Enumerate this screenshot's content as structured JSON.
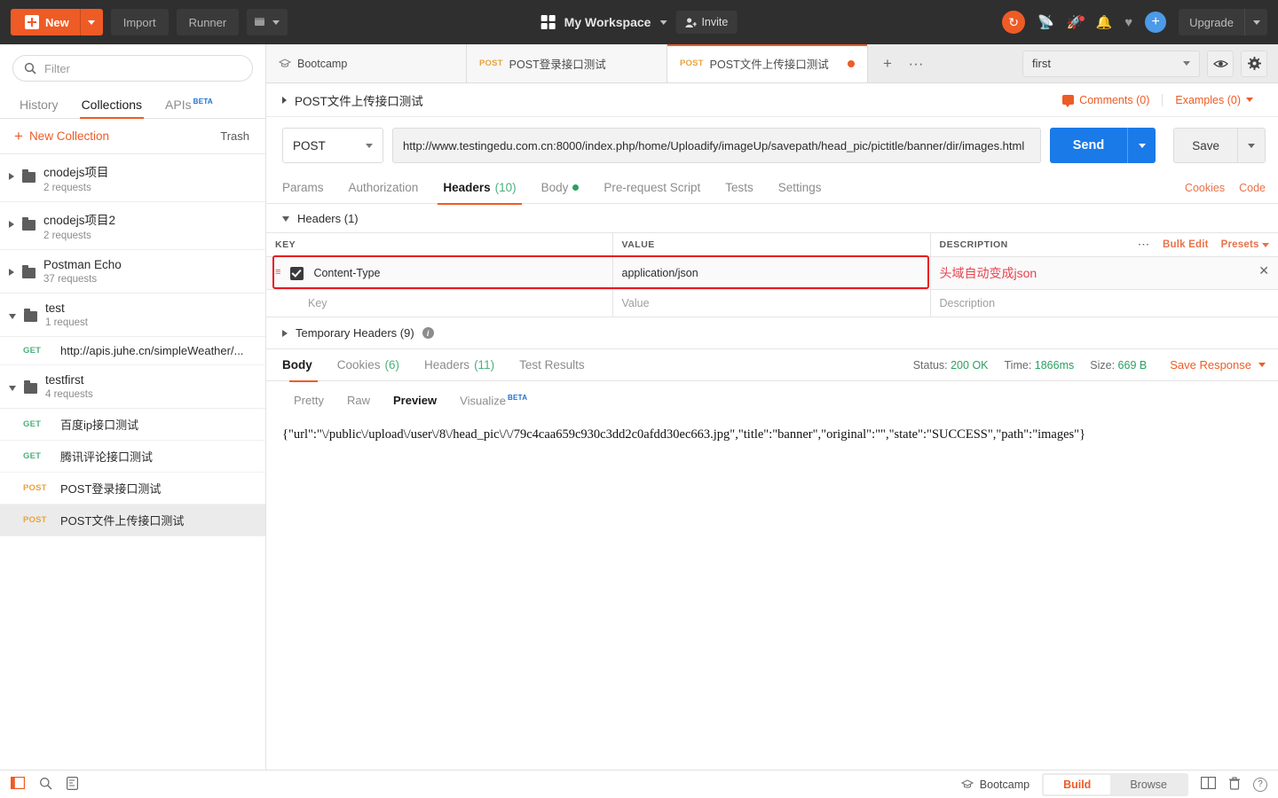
{
  "topbar": {
    "new_label": "New",
    "import_label": "Import",
    "runner_label": "Runner",
    "workspace_name": "My Workspace",
    "invite_label": "Invite",
    "upgrade_label": "Upgrade",
    "icons": [
      "sync-icon",
      "satellite-icon",
      "rocket-icon",
      "bell-icon",
      "heart-icon",
      "plus-circle-icon"
    ],
    "accent_color": "#ef5b25"
  },
  "sidebar": {
    "filter_placeholder": "Filter",
    "tabs": [
      {
        "label": "History",
        "active": false
      },
      {
        "label": "Collections",
        "active": true
      },
      {
        "label": "APIs",
        "active": false,
        "badge": "BETA"
      }
    ],
    "new_collection_label": "New Collection",
    "trash_label": "Trash",
    "collections": [
      {
        "name": "cnodejs项目",
        "count": "2 requests",
        "open": false,
        "requests": []
      },
      {
        "name": "cnodejs项目2",
        "count": "2 requests",
        "open": false,
        "requests": []
      },
      {
        "name": "Postman Echo",
        "count": "37 requests",
        "open": false,
        "requests": []
      },
      {
        "name": "test",
        "count": "1 request",
        "open": true,
        "requests": [
          {
            "method": "GET",
            "name": "http://apis.juhe.cn/simpleWeather/...",
            "selected": false
          }
        ]
      },
      {
        "name": "testfirst",
        "count": "4 requests",
        "open": true,
        "requests": [
          {
            "method": "GET",
            "name": "百度ip接口测试",
            "selected": false
          },
          {
            "method": "GET",
            "name": "腾讯评论接口测试",
            "selected": false
          },
          {
            "method": "POST",
            "name": "POST登录接口测试",
            "selected": false
          },
          {
            "method": "POST",
            "name": "POST文件上传接口测试",
            "selected": true
          }
        ]
      }
    ]
  },
  "tabstrip": {
    "tabs": [
      {
        "method": "",
        "title": "Bootcamp",
        "active": false,
        "unsaved": false,
        "icon": "bootcamp-icon"
      },
      {
        "method": "POST",
        "title": "POST登录接口测试",
        "active": false,
        "unsaved": false
      },
      {
        "method": "POST",
        "title": "POST文件上传接口测试",
        "active": true,
        "unsaved": true
      }
    ],
    "add_label": "+",
    "more_label": "···",
    "environment": "first"
  },
  "request": {
    "title": "POST文件上传接口测试",
    "comments_label": "Comments (0)",
    "examples_label": "Examples (0)",
    "method": "POST",
    "url": "http://www.testingedu.com.cn:8000/index.php/home/Uploadify/imageUp/savepath/head_pic/pictitle/banner/dir/images.html",
    "send_label": "Send",
    "save_label": "Save",
    "tabs": [
      {
        "label": "Params",
        "active": false
      },
      {
        "label": "Authorization",
        "active": false
      },
      {
        "label": "Headers",
        "count": "(10)",
        "active": true
      },
      {
        "label": "Body",
        "active": false,
        "dot": true
      },
      {
        "label": "Pre-request Script",
        "active": false
      },
      {
        "label": "Tests",
        "active": false
      },
      {
        "label": "Settings",
        "active": false
      }
    ],
    "cookies_link": "Cookies",
    "code_link": "Code"
  },
  "headers": {
    "section_label": "Headers (1)",
    "columns": [
      "KEY",
      "VALUE",
      "DESCRIPTION"
    ],
    "bulk_edit_label": "Bulk Edit",
    "presets_label": "Presets",
    "dots_label": "···",
    "rows": [
      {
        "checked": true,
        "key": "Content-Type",
        "value": "application/json",
        "description": "头域自动变成json",
        "highlighted": true
      }
    ],
    "placeholder_row": {
      "key": "Key",
      "value": "Value",
      "description": "Description"
    },
    "temporary_label": "Temporary Headers (9)",
    "annotation_color": "#e8434e",
    "highlight_color": "#e8161f"
  },
  "response": {
    "tabs": [
      {
        "label": "Body",
        "active": true
      },
      {
        "label": "Cookies",
        "count": "(6)",
        "active": false
      },
      {
        "label": "Headers",
        "count": "(11)",
        "active": false
      },
      {
        "label": "Test Results",
        "active": false
      }
    ],
    "status_label": "Status:",
    "status_value": "200 OK",
    "time_label": "Time:",
    "time_value": "1866ms",
    "size_label": "Size:",
    "size_value": "669 B",
    "save_response_label": "Save Response",
    "view_tabs": [
      {
        "label": "Pretty",
        "active": false
      },
      {
        "label": "Raw",
        "active": false
      },
      {
        "label": "Preview",
        "active": true
      },
      {
        "label": "Visualize",
        "active": false,
        "badge": "BETA"
      }
    ],
    "body_text": "{\"url\":\"\\/public\\/upload\\/user\\/8\\/head_pic\\/\\/79c4caa659c930c3dd2c0afdd30ec663.jpg\",\"title\":\"banner\",\"original\":\"\",\"state\":\"SUCCESS\",\"path\":\"images\"}"
  },
  "statusbar": {
    "left_icons": [
      "sidebar-toggle-icon",
      "search-icon",
      "console-icon"
    ],
    "bootcamp_label": "Bootcamp",
    "build_label": "Build",
    "browse_label": "Browse",
    "right_icons": [
      "two-pane-icon",
      "trash-icon",
      "help-icon"
    ]
  }
}
